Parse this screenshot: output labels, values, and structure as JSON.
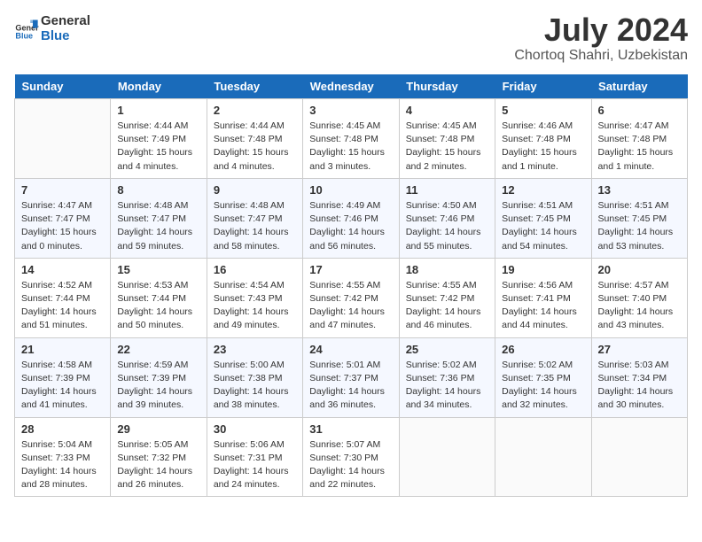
{
  "header": {
    "logo_line1": "General",
    "logo_line2": "Blue",
    "month_title": "July 2024",
    "location": "Chortoq Shahri, Uzbekistan"
  },
  "weekdays": [
    "Sunday",
    "Monday",
    "Tuesday",
    "Wednesday",
    "Thursday",
    "Friday",
    "Saturday"
  ],
  "weeks": [
    [
      {
        "day": "",
        "info": ""
      },
      {
        "day": "1",
        "info": "Sunrise: 4:44 AM\nSunset: 7:49 PM\nDaylight: 15 hours\nand 4 minutes."
      },
      {
        "day": "2",
        "info": "Sunrise: 4:44 AM\nSunset: 7:48 PM\nDaylight: 15 hours\nand 4 minutes."
      },
      {
        "day": "3",
        "info": "Sunrise: 4:45 AM\nSunset: 7:48 PM\nDaylight: 15 hours\nand 3 minutes."
      },
      {
        "day": "4",
        "info": "Sunrise: 4:45 AM\nSunset: 7:48 PM\nDaylight: 15 hours\nand 2 minutes."
      },
      {
        "day": "5",
        "info": "Sunrise: 4:46 AM\nSunset: 7:48 PM\nDaylight: 15 hours\nand 1 minute."
      },
      {
        "day": "6",
        "info": "Sunrise: 4:47 AM\nSunset: 7:48 PM\nDaylight: 15 hours\nand 1 minute."
      }
    ],
    [
      {
        "day": "7",
        "info": "Sunrise: 4:47 AM\nSunset: 7:47 PM\nDaylight: 15 hours\nand 0 minutes."
      },
      {
        "day": "8",
        "info": "Sunrise: 4:48 AM\nSunset: 7:47 PM\nDaylight: 14 hours\nand 59 minutes."
      },
      {
        "day": "9",
        "info": "Sunrise: 4:48 AM\nSunset: 7:47 PM\nDaylight: 14 hours\nand 58 minutes."
      },
      {
        "day": "10",
        "info": "Sunrise: 4:49 AM\nSunset: 7:46 PM\nDaylight: 14 hours\nand 56 minutes."
      },
      {
        "day": "11",
        "info": "Sunrise: 4:50 AM\nSunset: 7:46 PM\nDaylight: 14 hours\nand 55 minutes."
      },
      {
        "day": "12",
        "info": "Sunrise: 4:51 AM\nSunset: 7:45 PM\nDaylight: 14 hours\nand 54 minutes."
      },
      {
        "day": "13",
        "info": "Sunrise: 4:51 AM\nSunset: 7:45 PM\nDaylight: 14 hours\nand 53 minutes."
      }
    ],
    [
      {
        "day": "14",
        "info": "Sunrise: 4:52 AM\nSunset: 7:44 PM\nDaylight: 14 hours\nand 51 minutes."
      },
      {
        "day": "15",
        "info": "Sunrise: 4:53 AM\nSunset: 7:44 PM\nDaylight: 14 hours\nand 50 minutes."
      },
      {
        "day": "16",
        "info": "Sunrise: 4:54 AM\nSunset: 7:43 PM\nDaylight: 14 hours\nand 49 minutes."
      },
      {
        "day": "17",
        "info": "Sunrise: 4:55 AM\nSunset: 7:42 PM\nDaylight: 14 hours\nand 47 minutes."
      },
      {
        "day": "18",
        "info": "Sunrise: 4:55 AM\nSunset: 7:42 PM\nDaylight: 14 hours\nand 46 minutes."
      },
      {
        "day": "19",
        "info": "Sunrise: 4:56 AM\nSunset: 7:41 PM\nDaylight: 14 hours\nand 44 minutes."
      },
      {
        "day": "20",
        "info": "Sunrise: 4:57 AM\nSunset: 7:40 PM\nDaylight: 14 hours\nand 43 minutes."
      }
    ],
    [
      {
        "day": "21",
        "info": "Sunrise: 4:58 AM\nSunset: 7:39 PM\nDaylight: 14 hours\nand 41 minutes."
      },
      {
        "day": "22",
        "info": "Sunrise: 4:59 AM\nSunset: 7:39 PM\nDaylight: 14 hours\nand 39 minutes."
      },
      {
        "day": "23",
        "info": "Sunrise: 5:00 AM\nSunset: 7:38 PM\nDaylight: 14 hours\nand 38 minutes."
      },
      {
        "day": "24",
        "info": "Sunrise: 5:01 AM\nSunset: 7:37 PM\nDaylight: 14 hours\nand 36 minutes."
      },
      {
        "day": "25",
        "info": "Sunrise: 5:02 AM\nSunset: 7:36 PM\nDaylight: 14 hours\nand 34 minutes."
      },
      {
        "day": "26",
        "info": "Sunrise: 5:02 AM\nSunset: 7:35 PM\nDaylight: 14 hours\nand 32 minutes."
      },
      {
        "day": "27",
        "info": "Sunrise: 5:03 AM\nSunset: 7:34 PM\nDaylight: 14 hours\nand 30 minutes."
      }
    ],
    [
      {
        "day": "28",
        "info": "Sunrise: 5:04 AM\nSunset: 7:33 PM\nDaylight: 14 hours\nand 28 minutes."
      },
      {
        "day": "29",
        "info": "Sunrise: 5:05 AM\nSunset: 7:32 PM\nDaylight: 14 hours\nand 26 minutes."
      },
      {
        "day": "30",
        "info": "Sunrise: 5:06 AM\nSunset: 7:31 PM\nDaylight: 14 hours\nand 24 minutes."
      },
      {
        "day": "31",
        "info": "Sunrise: 5:07 AM\nSunset: 7:30 PM\nDaylight: 14 hours\nand 22 minutes."
      },
      {
        "day": "",
        "info": ""
      },
      {
        "day": "",
        "info": ""
      },
      {
        "day": "",
        "info": ""
      }
    ]
  ]
}
